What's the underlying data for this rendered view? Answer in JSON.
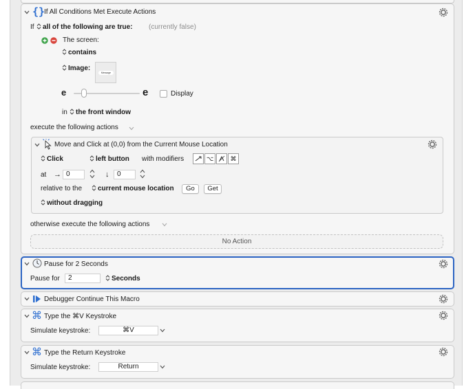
{
  "if_action": {
    "title": "If All Conditions Met Execute Actions",
    "if_label": "If",
    "match_mode": "all of the following are true:",
    "state": "(currently false)",
    "condition": {
      "label": "The screen:",
      "operator": "contains",
      "image_label": "Image:",
      "image_text": "Message",
      "slider_value": 0.12,
      "display_label": "Display",
      "display_checked": false,
      "scope_prefix": "in",
      "scope": "the front window"
    },
    "execute_label": "execute the following actions",
    "otherwise_label": "otherwise execute the following actions",
    "no_action": "No Action"
  },
  "move_click": {
    "title": "Move and Click at (0,0) from the Current Mouse Location",
    "click_type": "Click",
    "button": "left button",
    "with_modifiers": "with modifiers",
    "at_label": "at",
    "x_value": "0",
    "y_value": "0",
    "relative_label": "relative to the",
    "relative_to": "current mouse location",
    "go_label": "Go",
    "get_label": "Get",
    "dragging": "without dragging"
  },
  "pause": {
    "title": "Pause for 2 Seconds",
    "label": "Pause for",
    "value": "2",
    "unit": "Seconds"
  },
  "debugger": {
    "title": "Debugger Continue This Macro"
  },
  "keystroke1": {
    "title": "Type the ⌘V Keystroke",
    "label": "Simulate keystroke:",
    "value": "⌘V"
  },
  "keystroke2": {
    "title": "Type the Return Keystroke",
    "label": "Simulate keystroke:",
    "value": "Return"
  },
  "colors": {
    "selection": "#2a63c2",
    "panel": "#f6f6f6",
    "add": "#3ea34a",
    "remove": "#d8453c",
    "command_icon": "#2f6fd0"
  }
}
